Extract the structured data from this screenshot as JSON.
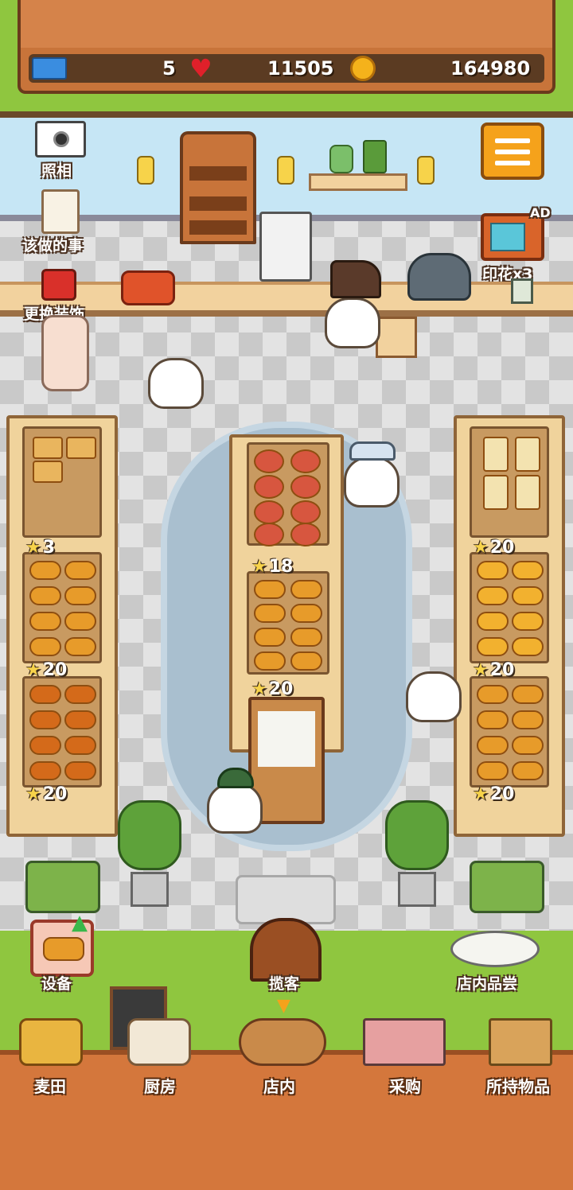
{
  "header": {
    "tickets": "5",
    "hearts": "11505",
    "coins": "164980"
  },
  "scene": {
    "photo_label": "照相",
    "todo_label": "该做的事",
    "decorate_label": "更换装饰",
    "stamp_label": "印花x3",
    "ad_badge": "AD",
    "equipment_label": "设备",
    "invite_label": "揽客",
    "tasting_label": "店内品尝"
  },
  "shelves": {
    "left_1": "3",
    "left_2": "20",
    "left_3": "20",
    "center_1": "18",
    "center_2": "20",
    "right_1": "20",
    "right_2": "20",
    "right_3": "20"
  },
  "bottom_nav": {
    "items": [
      {
        "label": "麦田"
      },
      {
        "label": "厨房"
      },
      {
        "label": "店内"
      },
      {
        "label": "采购"
      },
      {
        "label": "所持物品"
      }
    ]
  },
  "colors": {
    "wood": "#c8743a",
    "accent_orange": "#f5a21b",
    "grass": "#8fc63f"
  }
}
